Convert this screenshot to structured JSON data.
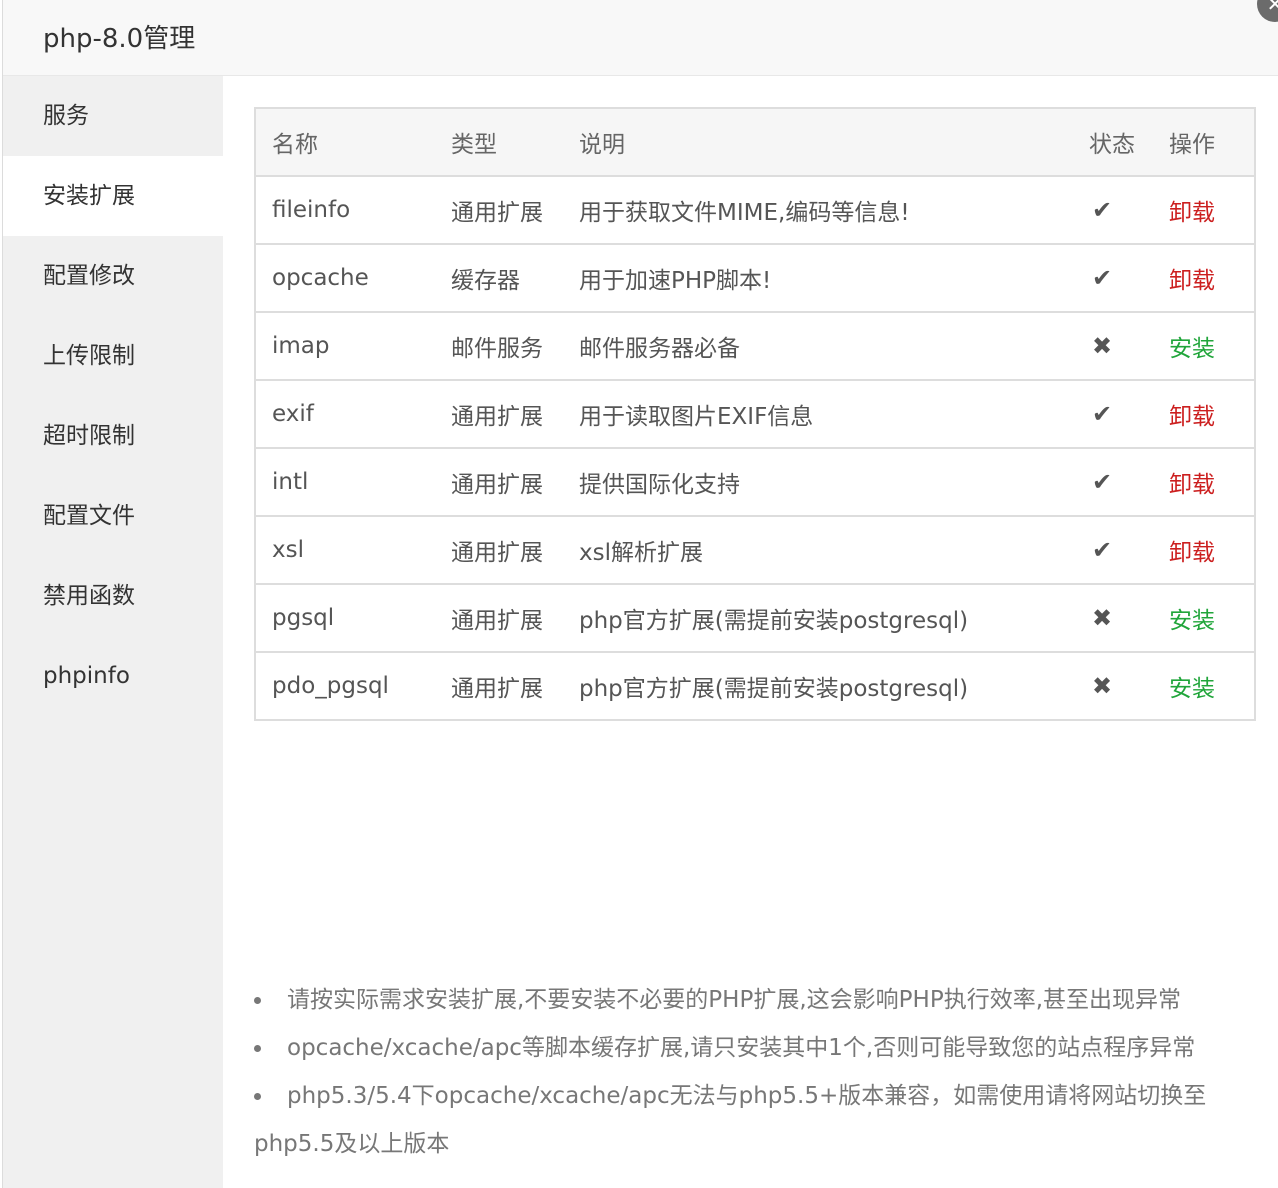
{
  "window": {
    "title": "php-8.0管理",
    "close_glyph": "✕"
  },
  "sidebar": {
    "items": [
      {
        "label": "服务",
        "active": false
      },
      {
        "label": "安装扩展",
        "active": true
      },
      {
        "label": "配置修改",
        "active": false
      },
      {
        "label": "上传限制",
        "active": false
      },
      {
        "label": "超时限制",
        "active": false
      },
      {
        "label": "配置文件",
        "active": false
      },
      {
        "label": "禁用函数",
        "active": false
      },
      {
        "label": "phpinfo",
        "active": false
      }
    ]
  },
  "table": {
    "headers": {
      "name": "名称",
      "type": "类型",
      "desc": "说明",
      "status": "状态",
      "op": "操作"
    },
    "rows": [
      {
        "name": "fileinfo",
        "type": "通用扩展",
        "desc": "用于获取文件MIME,编码等信息!",
        "status": "✔",
        "status_icon": "check-icon",
        "op": "卸载",
        "op_kind": "uninstall"
      },
      {
        "name": "opcache",
        "type": "缓存器",
        "desc": "用于加速PHP脚本!",
        "status": "✔",
        "status_icon": "check-icon",
        "op": "卸载",
        "op_kind": "uninstall"
      },
      {
        "name": "imap",
        "type": "邮件服务",
        "desc": "邮件服务器必备",
        "status": "✖",
        "status_icon": "cross-icon",
        "op": "安装",
        "op_kind": "install"
      },
      {
        "name": "exif",
        "type": "通用扩展",
        "desc": "用于读取图片EXIF信息",
        "status": "✔",
        "status_icon": "check-icon",
        "op": "卸载",
        "op_kind": "uninstall"
      },
      {
        "name": "intl",
        "type": "通用扩展",
        "desc": "提供国际化支持",
        "status": "✔",
        "status_icon": "check-icon",
        "op": "卸载",
        "op_kind": "uninstall"
      },
      {
        "name": "xsl",
        "type": "通用扩展",
        "desc": "xsl解析扩展",
        "status": "✔",
        "status_icon": "check-icon",
        "op": "卸载",
        "op_kind": "uninstall"
      },
      {
        "name": "pgsql",
        "type": "通用扩展",
        "desc": "php官方扩展(需提前安装postgresql)",
        "status": "✖",
        "status_icon": "cross-icon",
        "op": "安装",
        "op_kind": "install"
      },
      {
        "name": "pdo_pgsql",
        "type": "通用扩展",
        "desc": "php官方扩展(需提前安装postgresql)",
        "status": "✖",
        "status_icon": "cross-icon",
        "op": "安装",
        "op_kind": "install"
      }
    ]
  },
  "notes": [
    "请按实际需求安装扩展,不要安装不必要的PHP扩展,这会影响PHP执行效率,甚至出现异常",
    "opcache/xcache/apc等脚本缓存扩展,请只安装其中1个,否则可能导致您的站点程序异常",
    "php5.3/5.4下opcache/xcache/apc无法与php5.5+版本兼容，如需使用请将网站切换至php5.5及以上版本"
  ],
  "colors": {
    "uninstall": "#cc1f1f",
    "install": "#20a53a",
    "sidebar_bg": "#f0f0f0",
    "title_bg": "#f8f8f8"
  }
}
